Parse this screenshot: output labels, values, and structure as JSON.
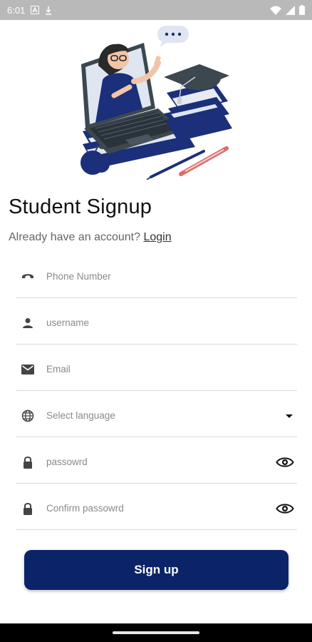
{
  "status_bar": {
    "time": "6:01"
  },
  "header": {
    "title": "Student Signup",
    "subtitle_prefix": "Already have an account?",
    "login_link": "Login"
  },
  "form": {
    "phone_placeholder": "Phone Number",
    "username_placeholder": "username",
    "email_placeholder": "Email",
    "language_placeholder": "Select language",
    "password_placeholder": "passowrd",
    "confirm_password_placeholder": "Confirm passowrd"
  },
  "actions": {
    "signup_label": "Sign up"
  },
  "colors": {
    "primary": "#0b2468",
    "illustration_navy": "#1b2f7a",
    "divider": "#d9d9d9"
  }
}
